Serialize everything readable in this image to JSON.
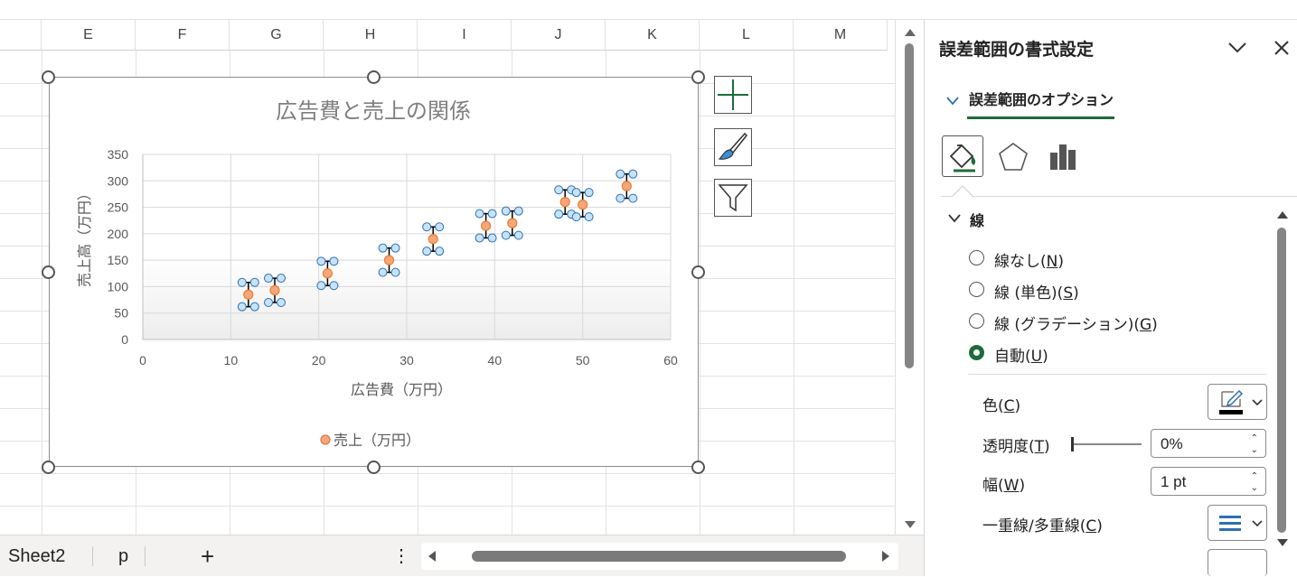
{
  "columns": [
    "E",
    "F",
    "G",
    "H",
    "I",
    "J",
    "K",
    "L",
    "M"
  ],
  "sheet_tabs": [
    "Sheet2",
    "p"
  ],
  "add_sheet_label": "+",
  "more_label": "⋮",
  "chart": {
    "title": "広告費と売上の関係",
    "xlabel": "広告費（万円）",
    "ylabel": "売上高（万円）",
    "legend": "売上（万円）"
  },
  "chart_data": {
    "type": "scatter",
    "title": "広告費と売上の関係",
    "xlabel": "広告費（万円）",
    "ylabel": "売上高（万円）",
    "xlim": [
      0,
      60
    ],
    "ylim": [
      0,
      350
    ],
    "xticks": [
      0,
      10,
      20,
      30,
      40,
      50,
      60
    ],
    "yticks": [
      0,
      50,
      100,
      150,
      200,
      250,
      300,
      350
    ],
    "grid": true,
    "legend_position": "bottom",
    "error_bar_plus": 23,
    "error_bar_minus": 23,
    "series": [
      {
        "name": "売上（万円）",
        "color": "#ed7d31",
        "x": [
          12,
          15,
          21,
          28,
          33,
          39,
          42,
          48,
          50,
          55
        ],
        "y": [
          85,
          93,
          125,
          150,
          190,
          215,
          220,
          260,
          255,
          290
        ]
      }
    ]
  },
  "panel": {
    "title": "誤差範囲の書式設定",
    "section_tab": "誤差範囲のオプション",
    "line_section": "線",
    "options": [
      {
        "label": "線なし(",
        "key": "N",
        "selected": false
      },
      {
        "label": "線 (単色)(",
        "key": "S",
        "selected": false
      },
      {
        "label": "線 (グラデーション)(",
        "key": "G",
        "selected": false
      },
      {
        "label": "自動(",
        "key": "U",
        "selected": true
      }
    ],
    "color_label": "色(",
    "color_key": "C",
    "transparency_label": "透明度(",
    "transparency_key": "T",
    "transparency_value": "0%",
    "width_label": "幅(",
    "width_key": "W",
    "width_value": "1 pt",
    "compound_label": "一重線/多重線(",
    "compound_key": "C",
    "accent_color": "#1e6b3a"
  }
}
